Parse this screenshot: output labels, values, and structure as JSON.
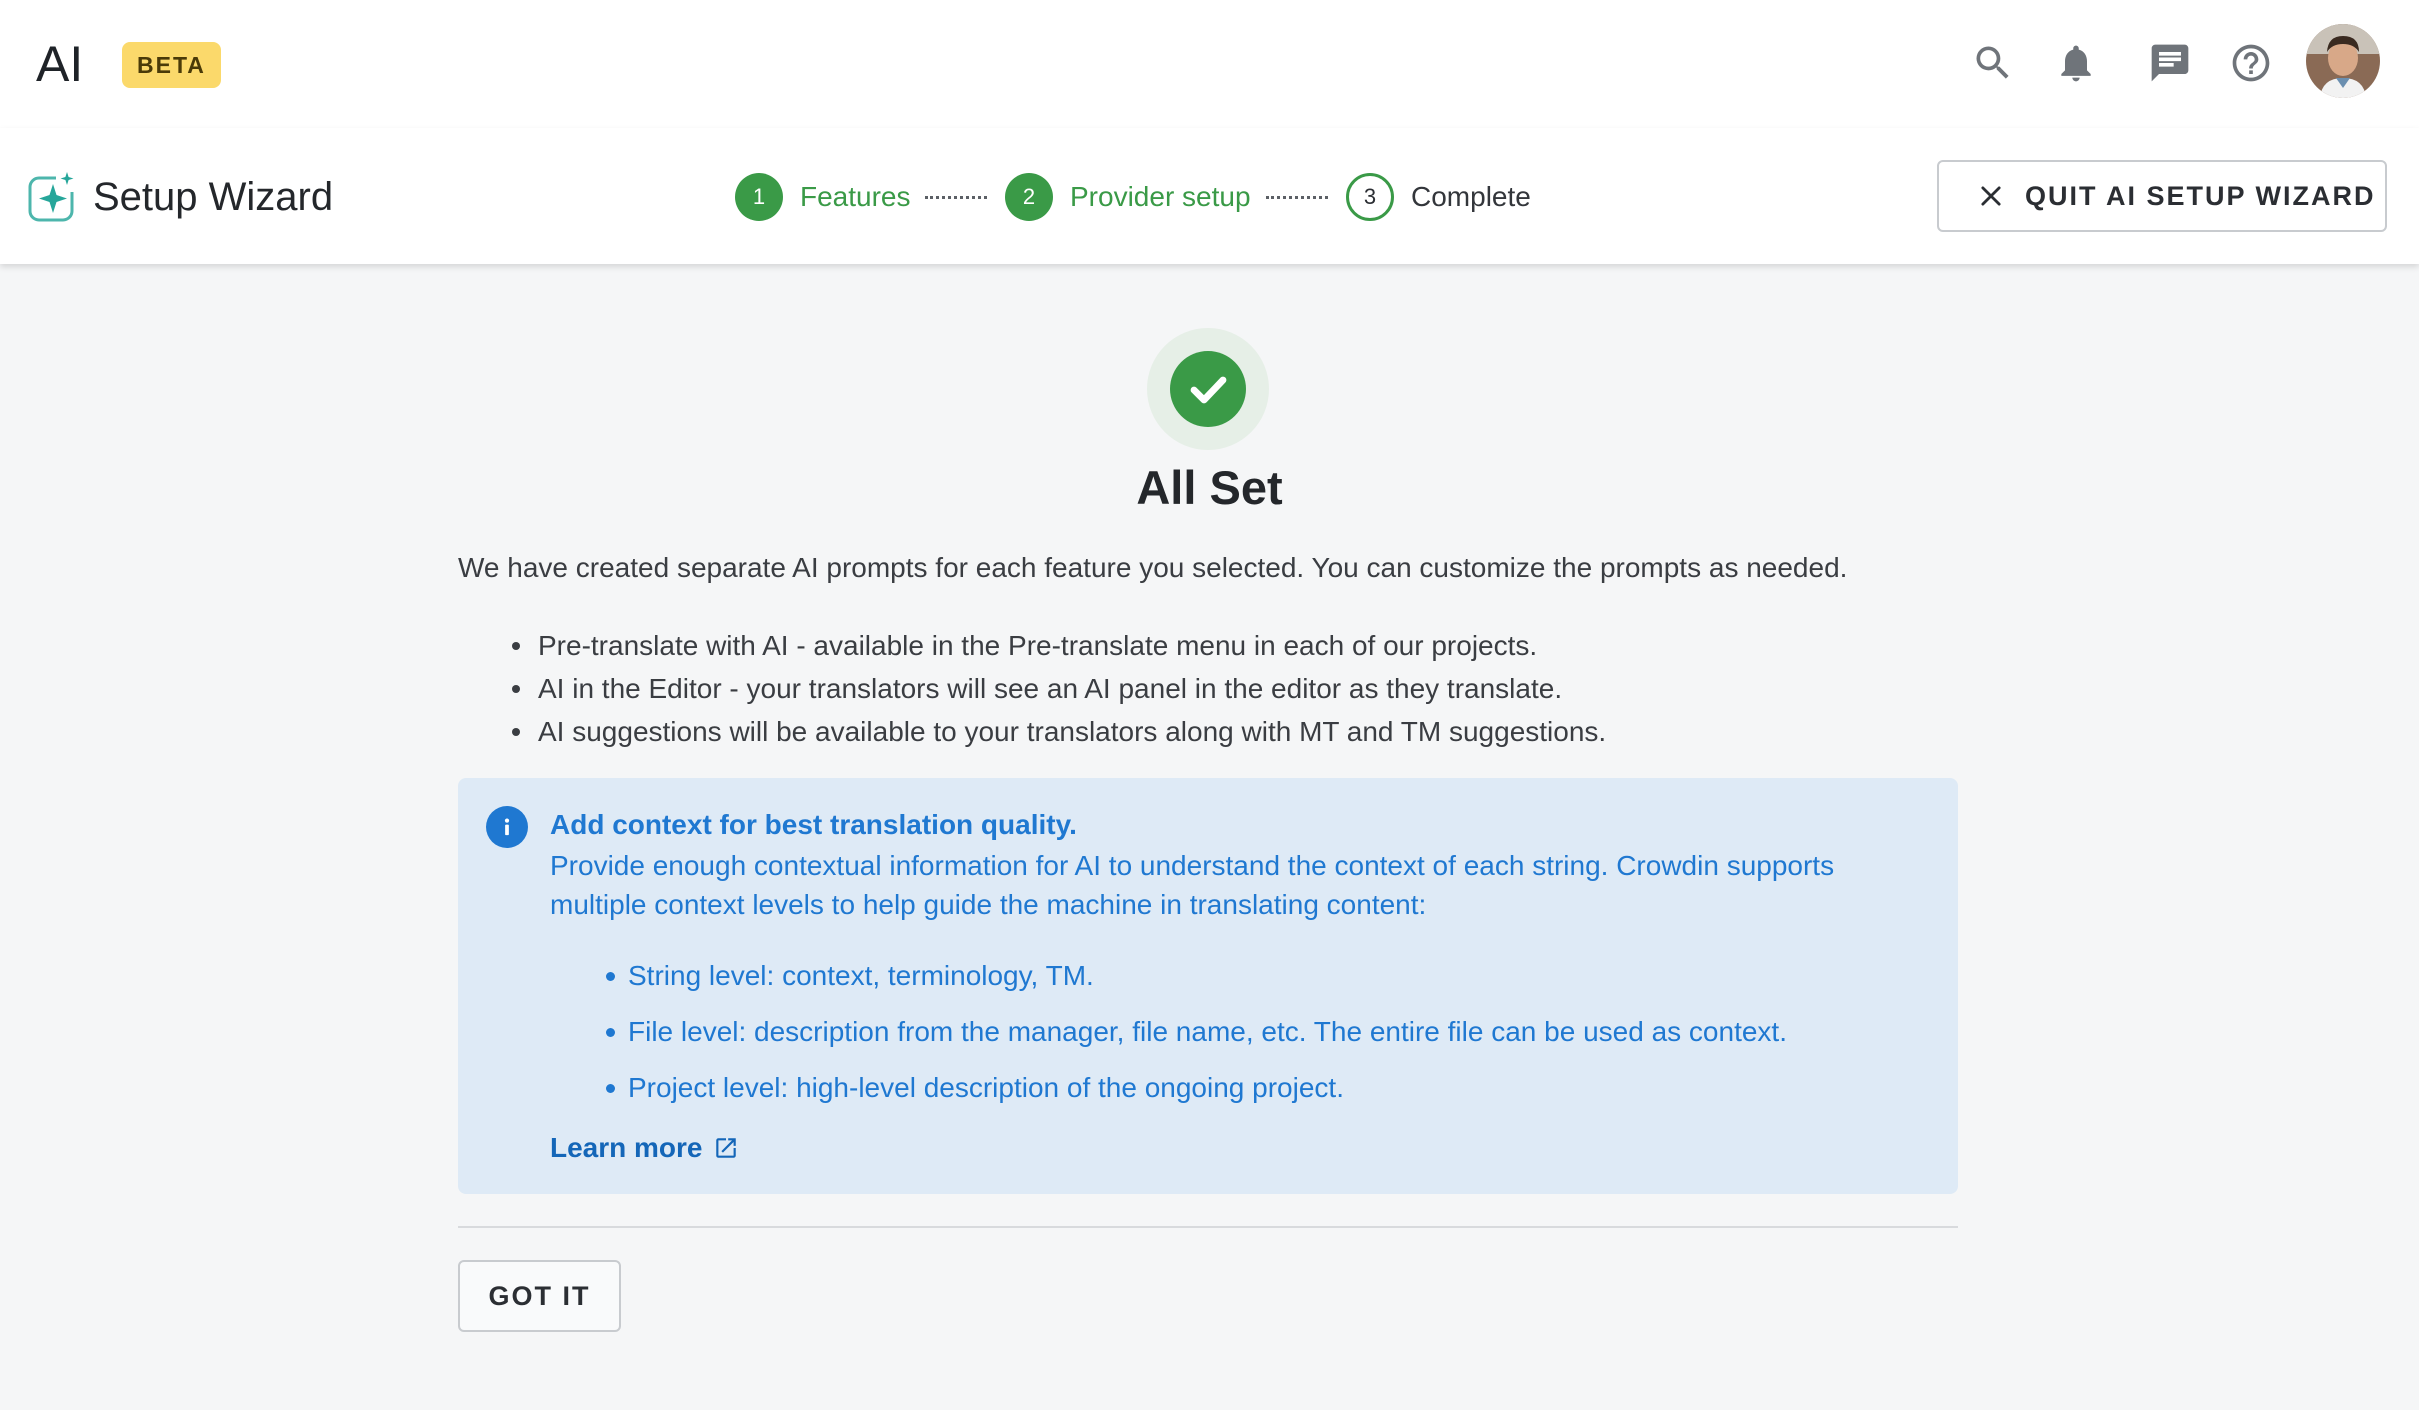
{
  "app": {
    "title": "AI",
    "badge": "BETA"
  },
  "topbar": {
    "icons": [
      "search-icon",
      "bell-icon",
      "chat-icon",
      "help-icon"
    ],
    "avatar": "user-avatar"
  },
  "wizard": {
    "title": "Setup Wizard",
    "steps": [
      {
        "number": "1",
        "label": "Features",
        "status": "done"
      },
      {
        "number": "2",
        "label": "Provider setup",
        "status": "done"
      },
      {
        "number": "3",
        "label": "Complete",
        "status": "current"
      }
    ],
    "quit_label": "QUIT AI SETUP WIZARD"
  },
  "main": {
    "heading": "All Set",
    "intro": "We have created separate AI prompts for each feature you selected. You can customize the prompts as needed.",
    "features": [
      "Pre-translate with AI - available in the Pre-translate menu in each of our projects.",
      "AI in the Editor - your translators will see an AI panel in the editor as they translate.",
      "AI suggestions will be available to your translators along with MT and TM suggestions."
    ],
    "info": {
      "title": "Add context for best translation quality.",
      "text": "Provide enough contextual information for AI to understand the context of each string. Crowdin supports multiple context levels to help guide the machine in translating content:",
      "items": [
        "String level: context, terminology, TM.",
        "File level: description from the manager, file name, etc. The entire file can be used as context.",
        "Project level: high-level description of the ongoing project."
      ],
      "link": "Learn more"
    },
    "got_it": "GOT IT"
  },
  "colors": {
    "success": "#3a9a47",
    "info": "#1f78d1",
    "info_bg": "#deeaf6",
    "beta_bg": "#fbd96b"
  }
}
